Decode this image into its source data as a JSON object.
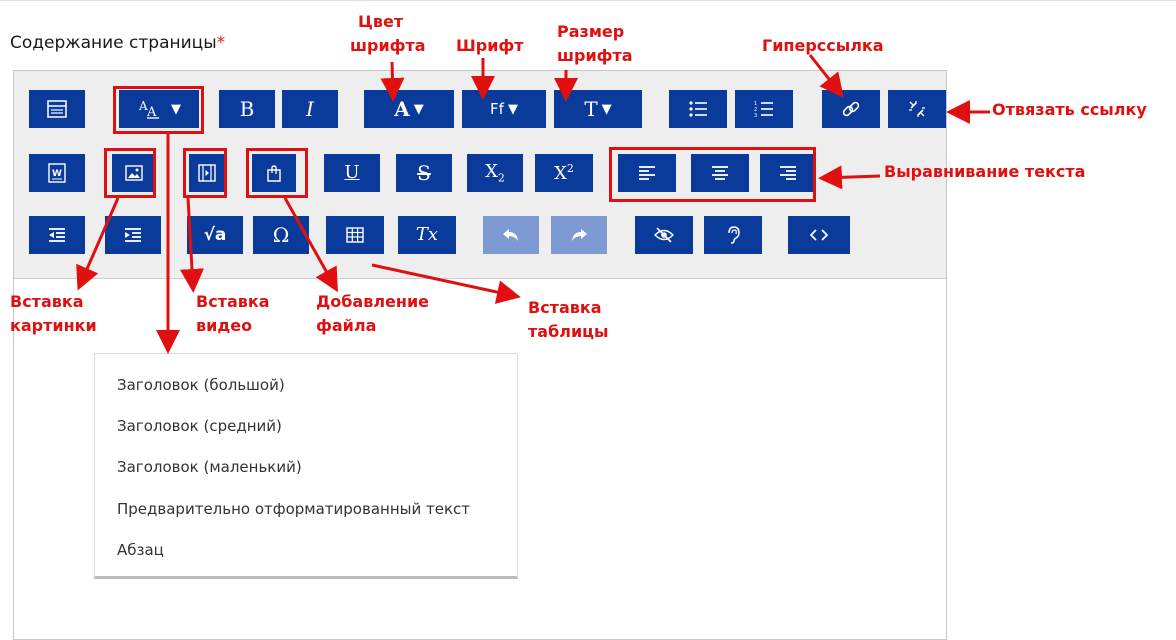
{
  "field": {
    "label": "Содержание страницы",
    "required_mark": "*"
  },
  "toolbar": {
    "row1": [
      "toolbar-toggle",
      "paragraph-styles",
      "bold",
      "italic",
      "font-color",
      "font-family",
      "font-size",
      "unordered-list",
      "ordered-list",
      "link",
      "unlink"
    ],
    "row2": [
      "word-import",
      "image",
      "video",
      "file",
      "underline",
      "strikethrough",
      "subscript",
      "superscript",
      "align-left",
      "align-center",
      "align-right"
    ],
    "row3": [
      "outdent",
      "indent",
      "equation",
      "special-char",
      "table",
      "clear-formatting",
      "undo",
      "redo",
      "accessibility-checker",
      "screen-reader",
      "html-source"
    ],
    "glyphs": {
      "bold": "B",
      "italic": "I",
      "underline": "U",
      "strikethrough": "S",
      "subscript_base": "X",
      "subscript_index": "2",
      "superscript_base": "X",
      "superscript_index": "2",
      "font_color": "A",
      "font_family": "Ff",
      "font_size": "T",
      "special_char": "Ω",
      "clear_formatting": "Tx",
      "equation": "√a",
      "caret": "▼"
    }
  },
  "dropdown": {
    "items": [
      "Заголовок (большой)",
      "Заголовок (средний)",
      "Заголовок (маленький)",
      "Предварительно отформатированный текст",
      "Абзац"
    ]
  },
  "annotations": {
    "font_color": [
      "Цвет",
      "шрифта"
    ],
    "font": "Шрифт",
    "font_size": [
      "Размер",
      "шрифта"
    ],
    "hyperlink": "Гиперссылка",
    "unlink": "Отвязать ссылку",
    "align": "Выравнивание текста",
    "insert_image": [
      "Вставка",
      "картинки"
    ],
    "insert_video": [
      "Вставка",
      "видео"
    ],
    "add_file": [
      "Добавление",
      "файла"
    ],
    "insert_table": [
      "Вставка",
      "таблицы"
    ]
  },
  "colors": {
    "button": "#0b3b9a",
    "button_disabled": "#7d9ad2",
    "annotation": "#e01010",
    "required": "#e02020"
  }
}
